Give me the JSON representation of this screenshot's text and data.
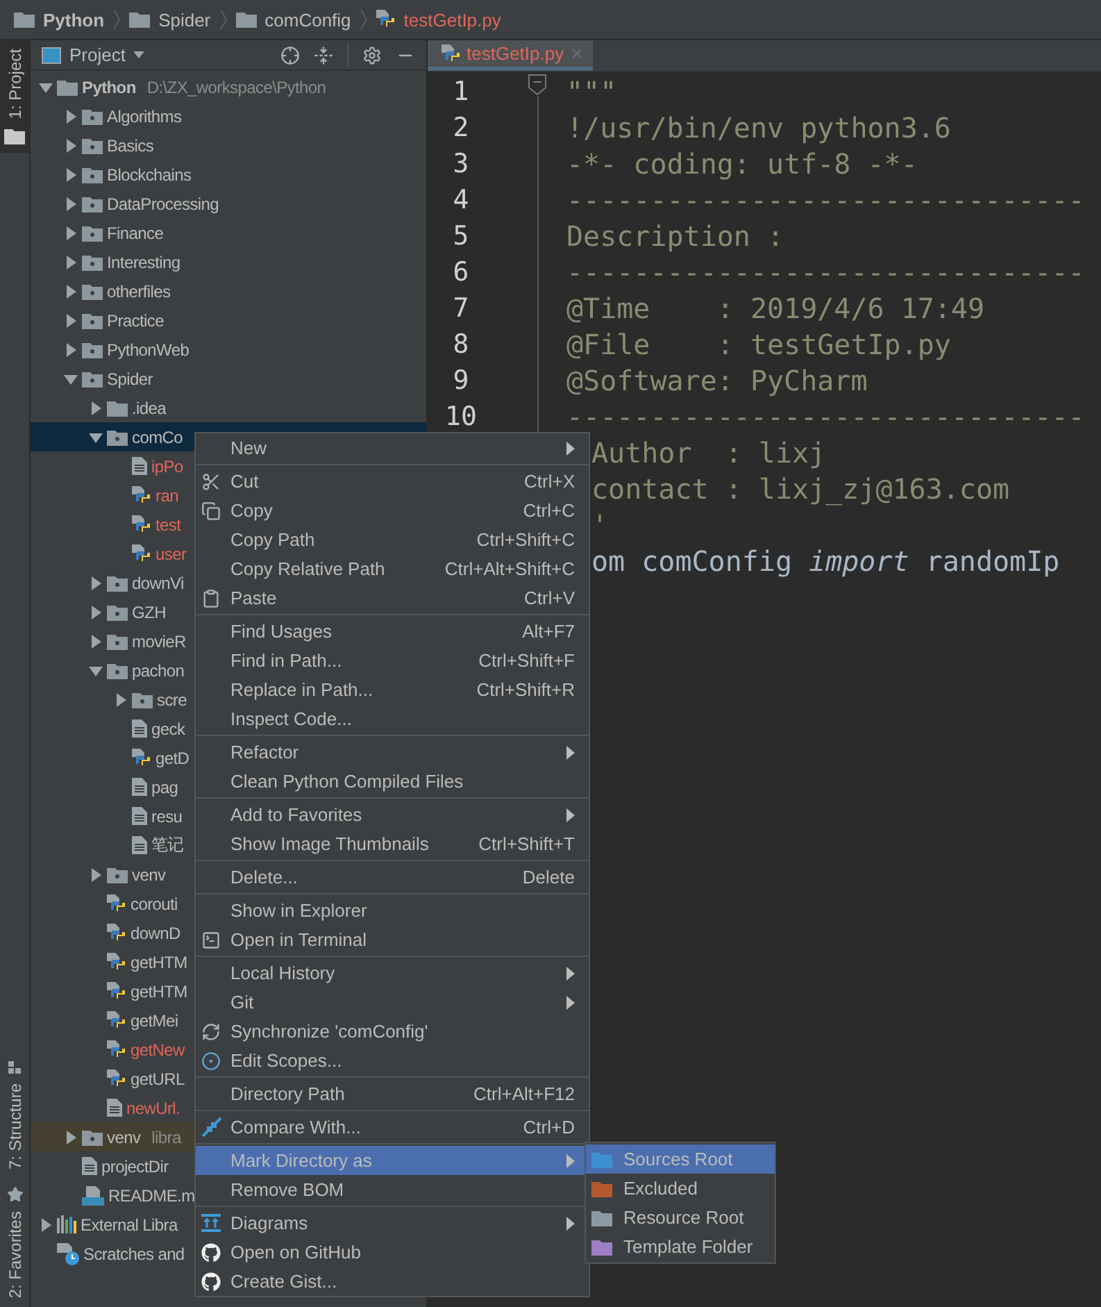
{
  "breadcrumb": [
    {
      "label": "Python",
      "kind": "folder",
      "bold": true
    },
    {
      "label": "Spider",
      "kind": "folder",
      "bold": false
    },
    {
      "label": "comConfig",
      "kind": "folder",
      "bold": false
    },
    {
      "label": "testGetIp.py",
      "kind": "python",
      "bold": false
    }
  ],
  "tool_strip": {
    "top": [
      {
        "label": "1: Project",
        "selected": true,
        "kind": "project"
      }
    ],
    "bottom": [
      {
        "label": "7: Structure",
        "selected": false,
        "kind": "structure"
      },
      {
        "label": "2: Favorites",
        "selected": false,
        "kind": "favorites"
      }
    ]
  },
  "project": {
    "title": "Project",
    "tree": [
      {
        "label": "Python",
        "note": "D:\\ZX_workspace\\Python",
        "kind": "folder-plain",
        "expanded": true,
        "selected": false,
        "new": false,
        "children": [
          {
            "label": "Algorithms",
            "kind": "folder",
            "expanded": false,
            "selected": false,
            "excluded": false,
            "new": false
          },
          {
            "label": "Basics",
            "kind": "folder",
            "expanded": false,
            "selected": false,
            "excluded": false,
            "new": false
          },
          {
            "label": "Blockchains",
            "kind": "folder",
            "expanded": false,
            "selected": false,
            "excluded": false,
            "new": false
          },
          {
            "label": "DataProcessing",
            "kind": "folder",
            "expanded": false,
            "selected": false,
            "excluded": false,
            "new": false
          },
          {
            "label": "Finance",
            "kind": "folder",
            "expanded": false,
            "selected": false,
            "excluded": false,
            "new": false
          },
          {
            "label": "Interesting",
            "kind": "folder",
            "expanded": false,
            "selected": false,
            "excluded": false,
            "new": false
          },
          {
            "label": "otherfiles",
            "kind": "folder",
            "expanded": false,
            "selected": false,
            "excluded": false,
            "new": false
          },
          {
            "label": "Practice",
            "kind": "folder",
            "expanded": false,
            "selected": false,
            "excluded": false,
            "new": false
          },
          {
            "label": "PythonWeb",
            "kind": "folder",
            "expanded": false,
            "selected": false,
            "excluded": false,
            "new": false
          },
          {
            "label": "Spider",
            "kind": "folder",
            "expanded": true,
            "selected": false,
            "excluded": false,
            "new": false,
            "children": [
              {
                "label": ".idea",
                "kind": "folder-plain",
                "expanded": false,
                "selected": false,
                "new": false
              },
              {
                "label": "comCo",
                "kind": "folder",
                "expanded": true,
                "selected": true,
                "new": false,
                "children": [
                  {
                    "label": "ipPo",
                    "kind": "file",
                    "selected": false,
                    "new": true
                  },
                  {
                    "label": "ran",
                    "kind": "python",
                    "selected": false,
                    "new": true
                  },
                  {
                    "label": "test",
                    "kind": "python",
                    "selected": false,
                    "new": true
                  },
                  {
                    "label": "user",
                    "kind": "python",
                    "selected": false,
                    "new": true
                  }
                ]
              },
              {
                "label": "downVi",
                "kind": "folder",
                "expanded": false,
                "selected": false,
                "new": false
              },
              {
                "label": "GZH",
                "kind": "folder",
                "expanded": false,
                "selected": false,
                "new": false
              },
              {
                "label": "movieR",
                "kind": "folder",
                "expanded": false,
                "selected": false,
                "new": false
              },
              {
                "label": "pachon",
                "kind": "folder",
                "expanded": true,
                "selected": false,
                "new": false,
                "children": [
                  {
                    "label": "scre",
                    "kind": "folder",
                    "expanded": false,
                    "selected": false,
                    "new": false
                  },
                  {
                    "label": "geck",
                    "kind": "file",
                    "selected": false,
                    "new": false
                  },
                  {
                    "label": "getD",
                    "kind": "python",
                    "selected": false,
                    "new": false
                  },
                  {
                    "label": "pag",
                    "kind": "file",
                    "selected": false,
                    "new": false
                  },
                  {
                    "label": "resu",
                    "kind": "file",
                    "selected": false,
                    "new": false
                  },
                  {
                    "label": "笔记",
                    "kind": "file",
                    "selected": false,
                    "new": false
                  }
                ]
              },
              {
                "label": "venv",
                "kind": "folder",
                "expanded": false,
                "selected": false,
                "new": false
              },
              {
                "label": "corouti",
                "kind": "python",
                "selected": false,
                "new": false
              },
              {
                "label": "downD",
                "kind": "python",
                "selected": false,
                "new": false
              },
              {
                "label": "getHTM",
                "kind": "python",
                "selected": false,
                "new": false
              },
              {
                "label": "getHTM",
                "kind": "python",
                "selected": false,
                "new": false
              },
              {
                "label": "getMei",
                "kind": "python",
                "selected": false,
                "new": false
              },
              {
                "label": "getNew",
                "kind": "python",
                "selected": false,
                "new": true
              },
              {
                "label": "getURL",
                "kind": "python",
                "selected": false,
                "new": false
              },
              {
                "label": "newUrl.",
                "kind": "file",
                "selected": false,
                "new": true
              }
            ]
          },
          {
            "label": "venv",
            "note": "libra",
            "kind": "folder",
            "expanded": false,
            "selected": false,
            "excluded": true,
            "new": false
          },
          {
            "label": "projectDir",
            "kind": "file",
            "selected": false,
            "excluded": false,
            "new": false
          },
          {
            "label": "README.m",
            "kind": "markdown",
            "selected": false,
            "excluded": false,
            "new": false
          }
        ]
      },
      {
        "label": "External Libra",
        "kind": "library",
        "expanded": false,
        "selected": false,
        "new": false
      },
      {
        "label": "Scratches and",
        "kind": "scratch",
        "selected": false,
        "new": false
      }
    ]
  },
  "editor": {
    "tabs": [
      {
        "label": "testGetIp.py",
        "selected": true
      }
    ],
    "lines": [
      {
        "number": "1",
        "text": "\"\"\"",
        "kind": "doc",
        "fold": true
      },
      {
        "number": "2",
        "text": "!/usr/bin/env python3.6",
        "kind": "doc",
        "fold": false
      },
      {
        "number": "3",
        "text": "-*- coding: utf-8 -*-",
        "kind": "doc",
        "fold": false
      },
      {
        "number": "4",
        "text": "-------------------------------",
        "kind": "doc",
        "fold": false
      },
      {
        "number": "5",
        "text": "Description :",
        "kind": "doc",
        "fold": false
      },
      {
        "number": "6",
        "text": "-------------------------------",
        "kind": "doc",
        "fold": false
      },
      {
        "number": "7",
        "text": "@Time    : 2019/4/6 17:49",
        "kind": "doc",
        "fold": false
      },
      {
        "number": "8",
        "text": "@File    : testGetIp.py",
        "kind": "doc",
        "fold": false
      },
      {
        "number": "9",
        "text": "@Software: PyCharm",
        "kind": "doc",
        "fold": false
      },
      {
        "number": "10",
        "text": "-------------------------------",
        "kind": "doc",
        "fold": false
      },
      {
        "text": "Author  : lixj",
        "kind": "doc"
      },
      {
        "text": "contact : lixj_zj@163.com",
        "kind": "doc"
      },
      {
        "text": "'",
        "kind": "doc"
      },
      {
        "text": "om comConfig *import* randomIp",
        "kind": "code"
      }
    ]
  },
  "context_menu": {
    "groups": [
      [
        {
          "label": "New",
          "submenu": true,
          "selected": false
        }
      ],
      [
        {
          "label": "Cut",
          "shortcut": "Ctrl+X",
          "submenu": false,
          "selected": false
        },
        {
          "label": "Copy",
          "shortcut": "Ctrl+C",
          "submenu": false,
          "selected": false
        },
        {
          "label": "Copy Path",
          "shortcut": "Ctrl+Shift+C",
          "submenu": false,
          "selected": false
        },
        {
          "label": "Copy Relative Path",
          "shortcut": "Ctrl+Alt+Shift+C",
          "submenu": false,
          "selected": false
        },
        {
          "label": "Paste",
          "shortcut": "Ctrl+V",
          "submenu": false,
          "selected": false
        }
      ],
      [
        {
          "label": "Find Usages",
          "shortcut": "Alt+F7",
          "submenu": false,
          "selected": false
        },
        {
          "label": "Find in Path...",
          "shortcut": "Ctrl+Shift+F",
          "submenu": false,
          "selected": false
        },
        {
          "label": "Replace in Path...",
          "shortcut": "Ctrl+Shift+R",
          "submenu": false,
          "selected": false
        },
        {
          "label": "Inspect Code...",
          "submenu": false,
          "selected": false
        }
      ],
      [
        {
          "label": "Refactor",
          "submenu": true,
          "selected": false
        },
        {
          "label": "Clean Python Compiled Files",
          "submenu": false,
          "selected": false
        }
      ],
      [
        {
          "label": "Add to Favorites",
          "submenu": true,
          "selected": false
        },
        {
          "label": "Show Image Thumbnails",
          "shortcut": "Ctrl+Shift+T",
          "submenu": false,
          "selected": false
        }
      ],
      [
        {
          "label": "Delete...",
          "shortcut": "Delete",
          "submenu": false,
          "selected": false
        }
      ],
      [
        {
          "label": "Show in Explorer",
          "submenu": false,
          "selected": false
        },
        {
          "label": "Open in Terminal",
          "submenu": false,
          "selected": false
        }
      ],
      [
        {
          "label": "Local History",
          "submenu": true,
          "selected": false
        },
        {
          "label": "Git",
          "submenu": true,
          "selected": false
        },
        {
          "label": "Synchronize 'comConfig'",
          "submenu": false,
          "selected": false
        },
        {
          "label": "Edit Scopes...",
          "submenu": false,
          "selected": false
        }
      ],
      [
        {
          "label": "Directory Path",
          "shortcut": "Ctrl+Alt+F12",
          "submenu": false,
          "selected": false
        }
      ],
      [
        {
          "label": "Compare With...",
          "shortcut": "Ctrl+D",
          "submenu": false,
          "selected": false
        }
      ],
      [
        {
          "label": "Mark Directory as",
          "submenu": true,
          "selected": true
        },
        {
          "label": "Remove BOM",
          "submenu": false,
          "selected": false
        }
      ],
      [
        {
          "label": "Diagrams",
          "submenu": true,
          "selected": false
        },
        {
          "label": "Open on GitHub",
          "submenu": false,
          "selected": false
        },
        {
          "label": "Create Gist...",
          "submenu": false,
          "selected": false
        }
      ]
    ]
  },
  "submenu": {
    "items": [
      {
        "label": "Sources Root",
        "color": "#3d8fd0",
        "selected": true
      },
      {
        "label": "Excluded",
        "color": "#b4582e",
        "selected": false
      },
      {
        "label": "Resource Root",
        "color": "#8e9aa3",
        "selected": false
      },
      {
        "label": "Template Folder",
        "color": "#9e7ec4",
        "selected": false
      }
    ]
  }
}
